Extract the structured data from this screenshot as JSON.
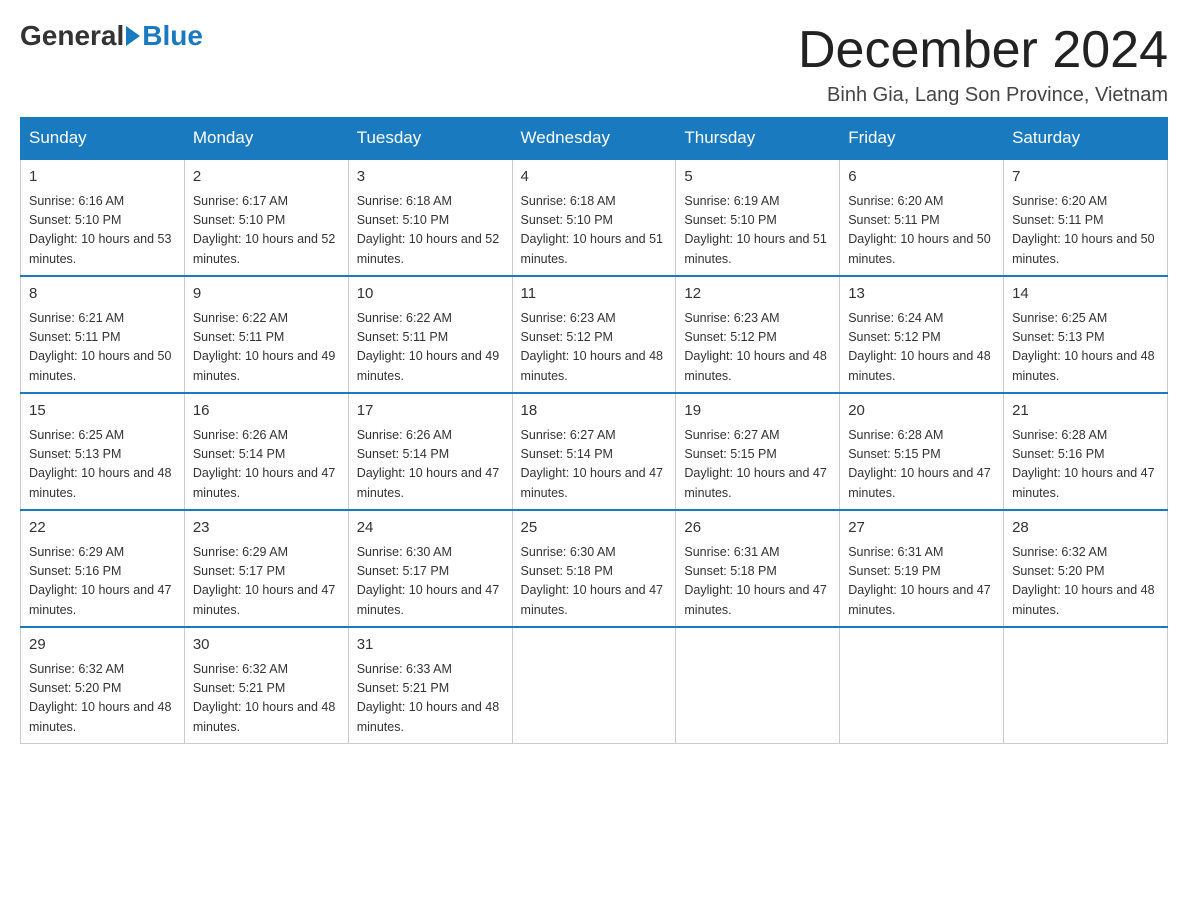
{
  "header": {
    "logo_general": "General",
    "logo_blue": "Blue",
    "month_year": "December 2024",
    "location": "Binh Gia, Lang Son Province, Vietnam"
  },
  "weekdays": [
    "Sunday",
    "Monday",
    "Tuesday",
    "Wednesday",
    "Thursday",
    "Friday",
    "Saturday"
  ],
  "weeks": [
    [
      {
        "day": "1",
        "sunrise": "6:16 AM",
        "sunset": "5:10 PM",
        "daylight": "10 hours and 53 minutes."
      },
      {
        "day": "2",
        "sunrise": "6:17 AM",
        "sunset": "5:10 PM",
        "daylight": "10 hours and 52 minutes."
      },
      {
        "day": "3",
        "sunrise": "6:18 AM",
        "sunset": "5:10 PM",
        "daylight": "10 hours and 52 minutes."
      },
      {
        "day": "4",
        "sunrise": "6:18 AM",
        "sunset": "5:10 PM",
        "daylight": "10 hours and 51 minutes."
      },
      {
        "day": "5",
        "sunrise": "6:19 AM",
        "sunset": "5:10 PM",
        "daylight": "10 hours and 51 minutes."
      },
      {
        "day": "6",
        "sunrise": "6:20 AM",
        "sunset": "5:11 PM",
        "daylight": "10 hours and 50 minutes."
      },
      {
        "day": "7",
        "sunrise": "6:20 AM",
        "sunset": "5:11 PM",
        "daylight": "10 hours and 50 minutes."
      }
    ],
    [
      {
        "day": "8",
        "sunrise": "6:21 AM",
        "sunset": "5:11 PM",
        "daylight": "10 hours and 50 minutes."
      },
      {
        "day": "9",
        "sunrise": "6:22 AM",
        "sunset": "5:11 PM",
        "daylight": "10 hours and 49 minutes."
      },
      {
        "day": "10",
        "sunrise": "6:22 AM",
        "sunset": "5:11 PM",
        "daylight": "10 hours and 49 minutes."
      },
      {
        "day": "11",
        "sunrise": "6:23 AM",
        "sunset": "5:12 PM",
        "daylight": "10 hours and 48 minutes."
      },
      {
        "day": "12",
        "sunrise": "6:23 AM",
        "sunset": "5:12 PM",
        "daylight": "10 hours and 48 minutes."
      },
      {
        "day": "13",
        "sunrise": "6:24 AM",
        "sunset": "5:12 PM",
        "daylight": "10 hours and 48 minutes."
      },
      {
        "day": "14",
        "sunrise": "6:25 AM",
        "sunset": "5:13 PM",
        "daylight": "10 hours and 48 minutes."
      }
    ],
    [
      {
        "day": "15",
        "sunrise": "6:25 AM",
        "sunset": "5:13 PM",
        "daylight": "10 hours and 48 minutes."
      },
      {
        "day": "16",
        "sunrise": "6:26 AM",
        "sunset": "5:14 PM",
        "daylight": "10 hours and 47 minutes."
      },
      {
        "day": "17",
        "sunrise": "6:26 AM",
        "sunset": "5:14 PM",
        "daylight": "10 hours and 47 minutes."
      },
      {
        "day": "18",
        "sunrise": "6:27 AM",
        "sunset": "5:14 PM",
        "daylight": "10 hours and 47 minutes."
      },
      {
        "day": "19",
        "sunrise": "6:27 AM",
        "sunset": "5:15 PM",
        "daylight": "10 hours and 47 minutes."
      },
      {
        "day": "20",
        "sunrise": "6:28 AM",
        "sunset": "5:15 PM",
        "daylight": "10 hours and 47 minutes."
      },
      {
        "day": "21",
        "sunrise": "6:28 AM",
        "sunset": "5:16 PM",
        "daylight": "10 hours and 47 minutes."
      }
    ],
    [
      {
        "day": "22",
        "sunrise": "6:29 AM",
        "sunset": "5:16 PM",
        "daylight": "10 hours and 47 minutes."
      },
      {
        "day": "23",
        "sunrise": "6:29 AM",
        "sunset": "5:17 PM",
        "daylight": "10 hours and 47 minutes."
      },
      {
        "day": "24",
        "sunrise": "6:30 AM",
        "sunset": "5:17 PM",
        "daylight": "10 hours and 47 minutes."
      },
      {
        "day": "25",
        "sunrise": "6:30 AM",
        "sunset": "5:18 PM",
        "daylight": "10 hours and 47 minutes."
      },
      {
        "day": "26",
        "sunrise": "6:31 AM",
        "sunset": "5:18 PM",
        "daylight": "10 hours and 47 minutes."
      },
      {
        "day": "27",
        "sunrise": "6:31 AM",
        "sunset": "5:19 PM",
        "daylight": "10 hours and 47 minutes."
      },
      {
        "day": "28",
        "sunrise": "6:32 AM",
        "sunset": "5:20 PM",
        "daylight": "10 hours and 48 minutes."
      }
    ],
    [
      {
        "day": "29",
        "sunrise": "6:32 AM",
        "sunset": "5:20 PM",
        "daylight": "10 hours and 48 minutes."
      },
      {
        "day": "30",
        "sunrise": "6:32 AM",
        "sunset": "5:21 PM",
        "daylight": "10 hours and 48 minutes."
      },
      {
        "day": "31",
        "sunrise": "6:33 AM",
        "sunset": "5:21 PM",
        "daylight": "10 hours and 48 minutes."
      },
      null,
      null,
      null,
      null
    ]
  ]
}
